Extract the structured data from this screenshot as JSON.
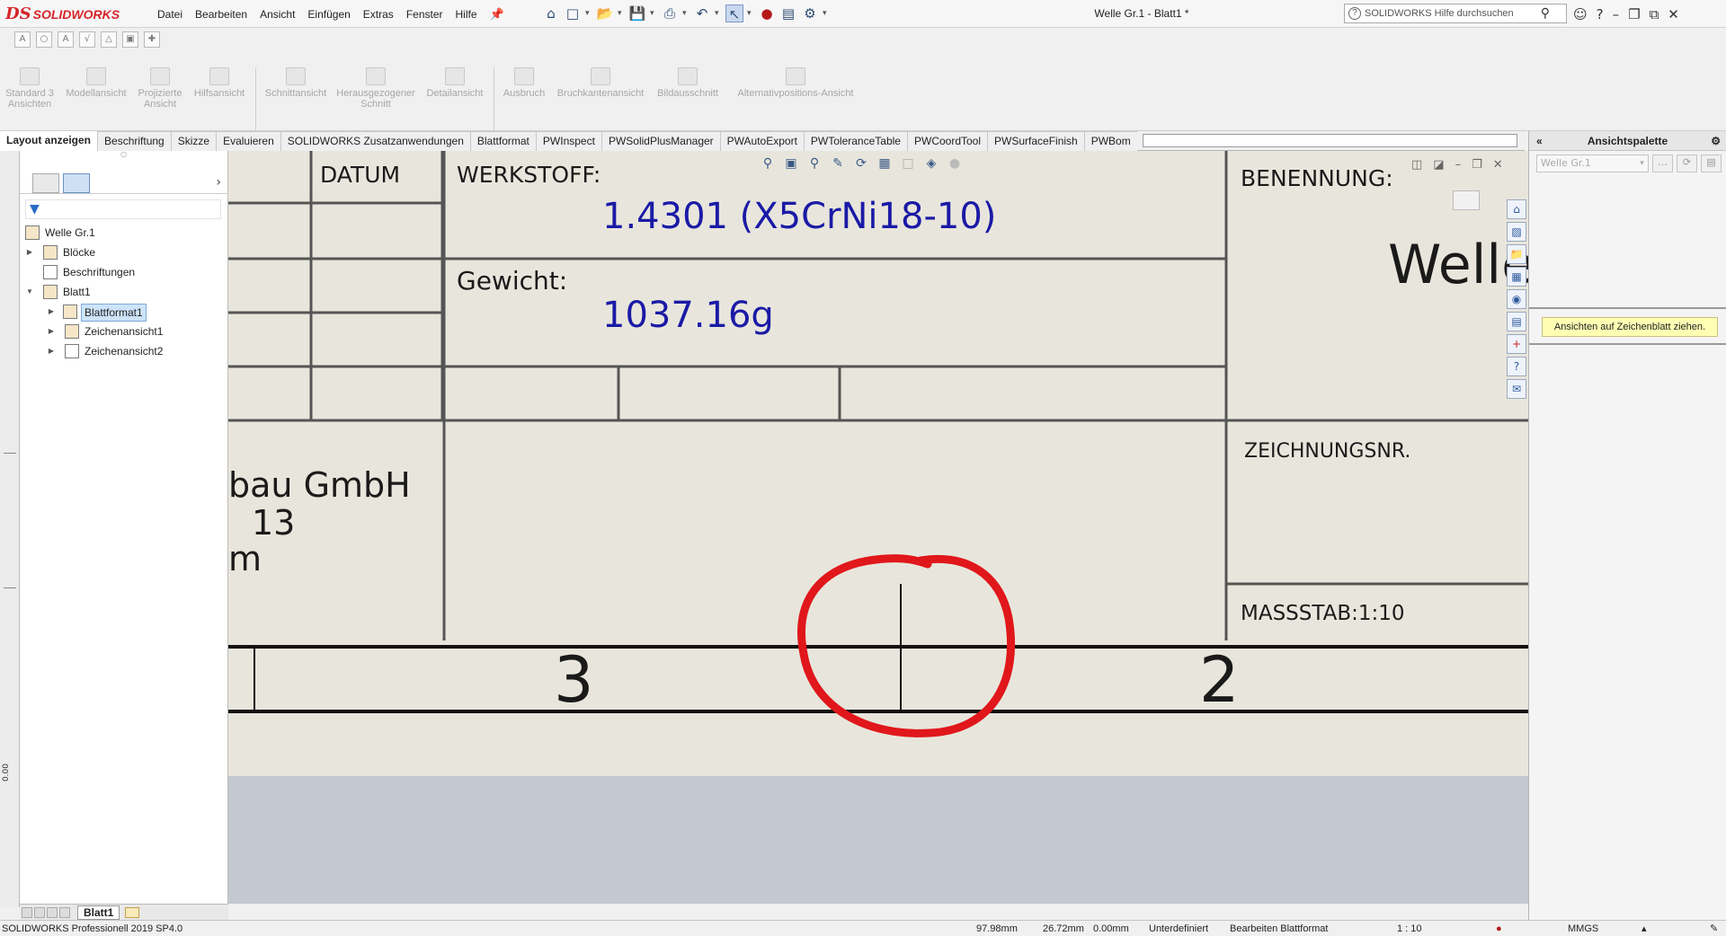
{
  "app": {
    "brand_ds": "DS",
    "brand_name": "SOLIDWORKS",
    "document_title": "Welle Gr.1 - Blatt1 *"
  },
  "menu": [
    "Datei",
    "Bearbeiten",
    "Ansicht",
    "Einfügen",
    "Extras",
    "Fenster",
    "Hilfe"
  ],
  "search": {
    "placeholder": "SOLIDWORKS Hilfe durchsuchen"
  },
  "commands": [
    {
      "label": "Standard 3 Ansichten"
    },
    {
      "label": "Modellansicht"
    },
    {
      "label": "Projizierte Ansicht"
    },
    {
      "label": "Hilfsansicht"
    },
    {
      "label": "Schnittansicht"
    },
    {
      "label": "Herausgezogener Schnitt"
    },
    {
      "label": "Detailansicht"
    },
    {
      "label": "Ausbruch"
    },
    {
      "label": "Bruchkantenansicht"
    },
    {
      "label": "Bildausschnitt"
    },
    {
      "label": "Alternativpositions-Ansicht"
    }
  ],
  "tabs": [
    "Layout anzeigen",
    "Beschriftung",
    "Skizze",
    "Evaluieren",
    "SOLIDWORKS Zusatzanwendungen",
    "Blattformat",
    "PWInspect",
    "PWSolidPlusManager",
    "PWAutoExport",
    "PWToleranceTable",
    "PWCoordTool",
    "PWSurfaceFinish",
    "PWBom"
  ],
  "tree": {
    "root": "Welle Gr.1",
    "items": [
      {
        "label": "Blöcke"
      },
      {
        "label": "Beschriftungen"
      },
      {
        "label": "Blatt1"
      },
      {
        "label": "Blattformat1"
      },
      {
        "label": "Zeichenansicht1"
      },
      {
        "label": "Zeichenansicht2"
      }
    ]
  },
  "sheet_tab": "Blatt1",
  "ruler_value": "0.00",
  "title_block": {
    "datum_label": "DATUM",
    "werkstoff_label": "WERKSTOFF:",
    "werkstoff_value": "1.4301 (X5CrNi18-10)",
    "gewicht_label": "Gewicht:",
    "gewicht_value": "1037.16g",
    "benennung_label": "BENENNUNG:",
    "benennung_value": "Welle",
    "company_line1": "bau GmbH",
    "company_line2": "13",
    "company_line3": "m",
    "zeichnungsnr_label": "ZEICHNUNGSNR.",
    "massstab_label": "MASSSTAB:1:10",
    "zone_left": "3",
    "zone_right": "2"
  },
  "palette": {
    "title": "Ansichtspalette",
    "select_value": "Welle Gr.1",
    "tip": "Ansichten auf Zeichenblatt ziehen."
  },
  "status": {
    "product": "SOLIDWORKS Professionell 2019 SP4.0",
    "x": "97.98mm",
    "y": "26.72mm",
    "z": "0.00mm",
    "state": "Unterdefiniert",
    "mode": "Bearbeiten Blattformat",
    "scale": "1 : 10",
    "units": "MMGS"
  },
  "colors": {
    "brand_red": "#d6252a",
    "sheet_bg": "#e8e6dc",
    "value_blue": "#1a1aa6",
    "annotation_red": "#e0171b",
    "tip_yellow": "#ffffb4"
  }
}
